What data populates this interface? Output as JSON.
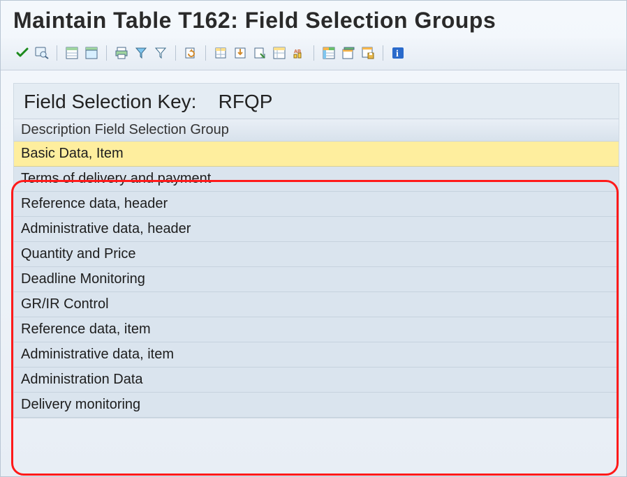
{
  "window": {
    "title": "Maintain Table T162: Field Selection Groups"
  },
  "toolbar": {
    "icons": [
      {
        "name": "checkmark-icon",
        "color": "#2e8b2e"
      },
      {
        "name": "details-icon"
      },
      {
        "sep": true
      },
      {
        "name": "table-select-icon"
      },
      {
        "name": "table-all-icon"
      },
      {
        "sep": true
      },
      {
        "name": "print-icon"
      },
      {
        "name": "filter-down-icon"
      },
      {
        "name": "filter-icon"
      },
      {
        "sep": true
      },
      {
        "name": "refresh-icon"
      },
      {
        "sep": true
      },
      {
        "name": "export-xls-icon"
      },
      {
        "name": "export-word-icon"
      },
      {
        "name": "export-local-icon"
      },
      {
        "name": "abc-sort-icon"
      },
      {
        "name": "graphic-icon"
      },
      {
        "sep": true
      },
      {
        "name": "layout-change-icon"
      },
      {
        "name": "layout-select-icon"
      },
      {
        "name": "layout-save-icon"
      },
      {
        "sep": true
      },
      {
        "name": "info-icon"
      }
    ]
  },
  "subpane": {
    "label": "Field Selection Key:",
    "key": "RFQP",
    "column_header": "Description  Field Selection Group"
  },
  "rows": [
    {
      "desc": "Basic Data, Item",
      "selected": true
    },
    {
      "desc": "Terms of delivery and payment",
      "selected": false
    },
    {
      "desc": "Reference data, header",
      "selected": false
    },
    {
      "desc": "Administrative data, header",
      "selected": false
    },
    {
      "desc": "Quantity and Price",
      "selected": false
    },
    {
      "desc": "Deadline Monitoring",
      "selected": false
    },
    {
      "desc": "GR/IR Control",
      "selected": false
    },
    {
      "desc": "Reference data, item",
      "selected": false
    },
    {
      "desc": "Administrative data, item",
      "selected": false
    },
    {
      "desc": "Administration Data",
      "selected": false
    },
    {
      "desc": "Delivery monitoring",
      "selected": false
    }
  ]
}
